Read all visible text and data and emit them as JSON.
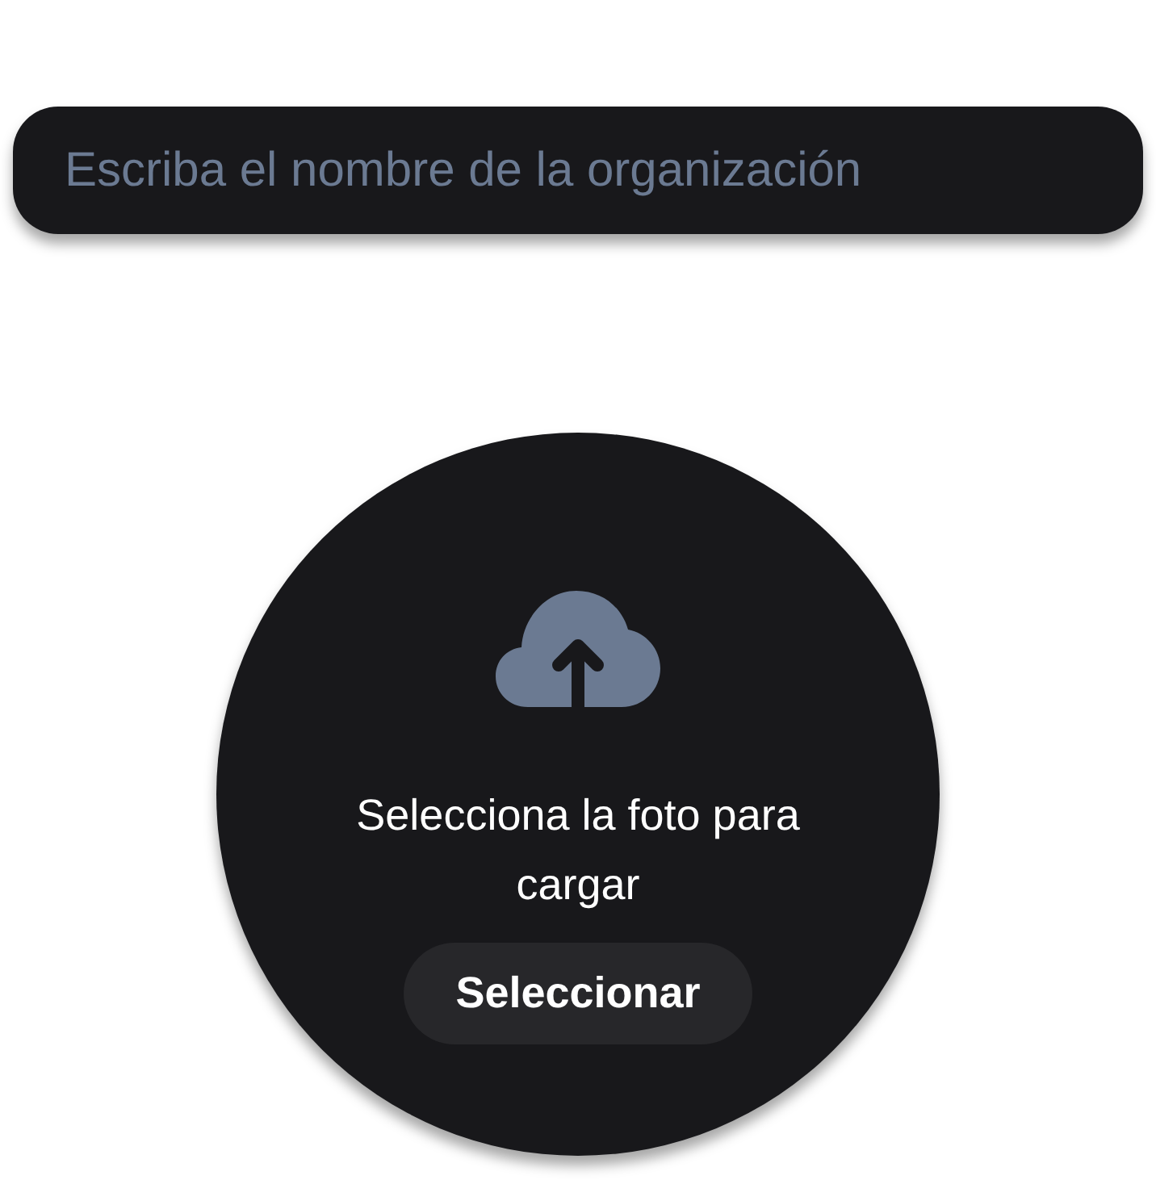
{
  "organization_field": {
    "placeholder": "Escriba el nombre de la organización"
  },
  "photo_upload": {
    "prompt": "Selecciona la foto para cargar",
    "button": "Seleccionar"
  }
}
